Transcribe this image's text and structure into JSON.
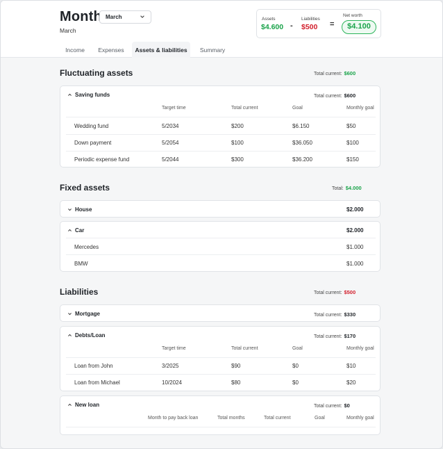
{
  "header": {
    "title": "Month",
    "month_select": "March",
    "subtitle": "March",
    "tabs": [
      {
        "label": "Income",
        "active": false
      },
      {
        "label": "Expenses",
        "active": false
      },
      {
        "label": "Assets & liabilities",
        "active": true
      },
      {
        "label": "Summary",
        "active": false
      }
    ]
  },
  "summary": {
    "assets_label": "Assets",
    "assets_value": "$4.600",
    "minus": "-",
    "liabilities_label": "Liabilities",
    "liabilities_value": "$500",
    "equals": "=",
    "net_worth_label": "Net worth",
    "net_worth_value": "$4.100"
  },
  "fluctuating": {
    "title": "Fluctuating assets",
    "total_label": "Total current:",
    "total_value": "$600",
    "saving_funds": {
      "title": "Saving funds",
      "total_label": "Total current:",
      "total_value": "$600",
      "columns": [
        "Target time",
        "Total current",
        "Goal",
        "Monthly goal"
      ],
      "rows": [
        {
          "name": "Wedding fund",
          "target": "5/2034",
          "current": "$200",
          "goal": "$6.150",
          "monthly": "$50"
        },
        {
          "name": "Down payment",
          "target": "5/2054",
          "current": "$100",
          "goal": "$36.050",
          "monthly": "$100"
        },
        {
          "name": "Periodic expense fund",
          "target": "5/2044",
          "current": "$300",
          "goal": "$36.200",
          "monthly": "$150"
        }
      ]
    }
  },
  "fixed": {
    "title": "Fixed assets",
    "total_label": "Total:",
    "total_value": "$4.000",
    "house": {
      "title": "House",
      "value": "$2.000"
    },
    "car": {
      "title": "Car",
      "value": "$2.000",
      "items": [
        {
          "name": "Mercedes",
          "value": "$1.000"
        },
        {
          "name": "BMW",
          "value": "$1.000"
        }
      ]
    }
  },
  "liabilities": {
    "title": "Liabilities",
    "total_label": "Total current:",
    "total_value": "$500",
    "mortgage": {
      "title": "Mortgage",
      "total_label": "Total current:",
      "total_value": "$330"
    },
    "debts": {
      "title": "Debts/Loan",
      "total_label": "Total current:",
      "total_value": "$170",
      "columns": [
        "Target time",
        "Total current",
        "Goal",
        "Monthly goal"
      ],
      "rows": [
        {
          "name": "Loan from John",
          "target": "3/2025",
          "current": "$90",
          "goal": "$0",
          "monthly": "$10"
        },
        {
          "name": "Loan from Michael",
          "target": "10/2024",
          "current": "$80",
          "goal": "$0",
          "monthly": "$20"
        }
      ]
    },
    "new_loan": {
      "title": "New loan",
      "total_label": "Total current:",
      "total_value": "$0",
      "columns": [
        "Month to pay back loan",
        "Total months",
        "Total current",
        "Goal",
        "Monthly goal"
      ]
    }
  },
  "colors": {
    "positive": "#1aa34a",
    "negative": "#d21f2c",
    "accent_green_bg": "#eefaf2"
  }
}
